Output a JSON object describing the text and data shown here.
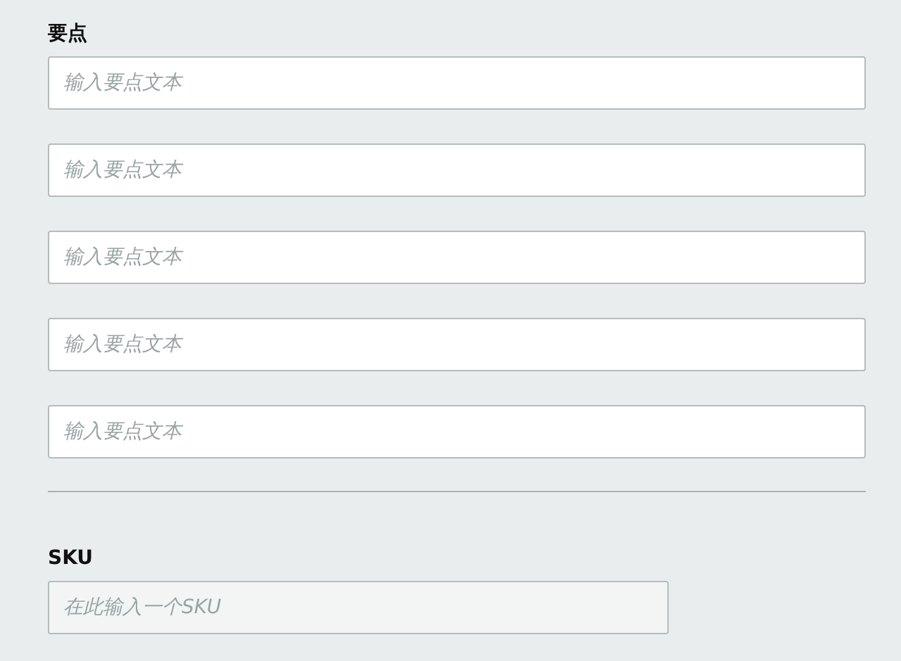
{
  "bullet_points": {
    "label": "要点",
    "fields": [
      {
        "placeholder": "输入要点文本"
      },
      {
        "placeholder": "输入要点文本"
      },
      {
        "placeholder": "输入要点文本"
      },
      {
        "placeholder": "输入要点文本"
      },
      {
        "placeholder": "输入要点文本"
      }
    ]
  },
  "sku": {
    "label": "SKU",
    "placeholder": "在此输入一个SKU"
  }
}
